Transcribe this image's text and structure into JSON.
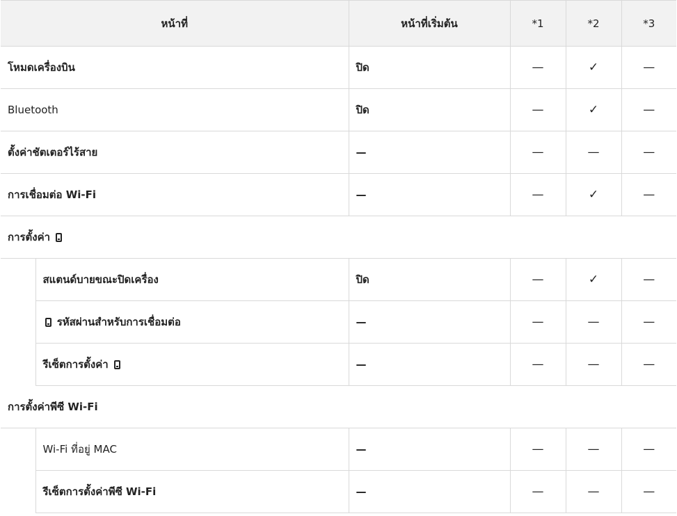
{
  "header": {
    "function": "หน้าที่",
    "default": "หน้าที่เริ่มต้น",
    "c1": "*1",
    "c2": "*2",
    "c3": "*3"
  },
  "rows": [
    {
      "name": "โหมดเครื่องบิน",
      "default": "ปิด",
      "c1": "—",
      "c2": "✓",
      "c3": "—"
    },
    {
      "name": "Bluetooth",
      "default": "ปิด",
      "c1": "—",
      "c2": "✓",
      "c3": "—"
    },
    {
      "name": "ตั้งค่าชัตเตอร์ไร้สาย",
      "default": "—",
      "c1": "—",
      "c2": "—",
      "c3": "—"
    },
    {
      "name": "การเชื่อมต่อ Wi-Fi",
      "default": "—",
      "c1": "—",
      "c2": "✓",
      "c3": "—"
    }
  ],
  "section1": {
    "title": "การตั้งค่า",
    "rows": [
      {
        "name": "สแตนด์บายขณะปิดเครื่อง",
        "default": "ปิด",
        "c1": "—",
        "c2": "✓",
        "c3": "—"
      },
      {
        "name": "รหัสผ่านสำหรับการเชื่อมต่อ",
        "default": "—",
        "c1": "—",
        "c2": "—",
        "c3": "—"
      },
      {
        "name": "รีเซ็ตการตั้งค่า",
        "default": "—",
        "c1": "—",
        "c2": "—",
        "c3": "—"
      }
    ]
  },
  "section2": {
    "title": "การตั้งค่าพีซี Wi-Fi",
    "rows": [
      {
        "name": "Wi-Fi ที่อยู่ MAC",
        "default": "—",
        "c1": "—",
        "c2": "—",
        "c3": "—"
      },
      {
        "name": "รีเซ็ตการตั้งค่าพีซี Wi-Fi",
        "default": "—",
        "c1": "—",
        "c2": "—",
        "c3": "—"
      }
    ]
  },
  "icons": {
    "phone": "smartphone-icon"
  }
}
